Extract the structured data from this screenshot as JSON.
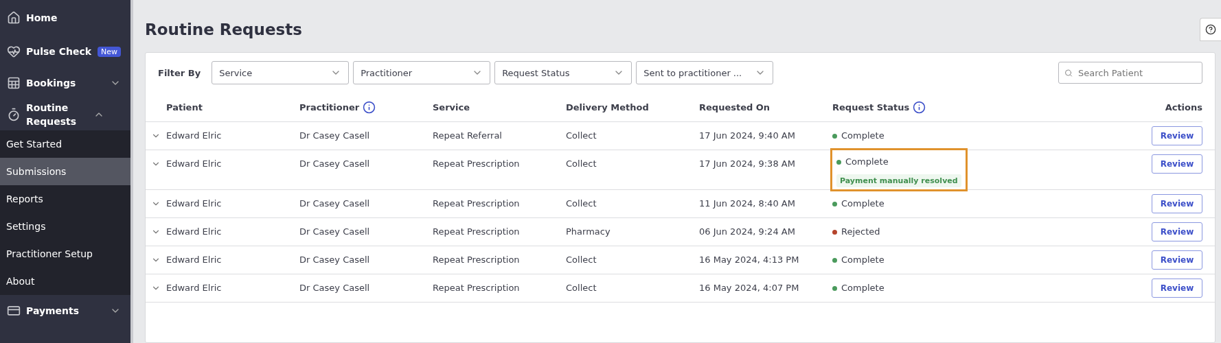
{
  "sidebar": {
    "items": [
      {
        "label": "Home"
      },
      {
        "label": "Pulse Check",
        "badge": "New"
      },
      {
        "label": "Bookings",
        "expanded": false
      },
      {
        "label": "Routine Requests",
        "expanded": true,
        "children": [
          {
            "label": "Get Started",
            "selected": false
          },
          {
            "label": "Submissions",
            "selected": true
          },
          {
            "label": "Reports",
            "selected": false
          },
          {
            "label": "Settings",
            "selected": false
          },
          {
            "label": "Practitioner Setup",
            "selected": false
          },
          {
            "label": "About",
            "selected": false
          }
        ]
      },
      {
        "label": "Payments",
        "expanded": false
      }
    ]
  },
  "page": {
    "title": "Routine Requests"
  },
  "filters": {
    "label": "Filter By",
    "selects": [
      "Service",
      "Practitioner",
      "Request Status",
      "Sent to practitioner ..."
    ],
    "search": {
      "placeholder": "Search Patient"
    }
  },
  "table": {
    "columns": [
      {
        "label": "Patient",
        "info": false
      },
      {
        "label": "Practitioner",
        "info": true
      },
      {
        "label": "Service",
        "info": false
      },
      {
        "label": "Delivery Method",
        "info": false
      },
      {
        "label": "Requested On",
        "info": false
      },
      {
        "label": "Request Status",
        "info": true
      },
      {
        "label": "Actions",
        "info": false
      }
    ],
    "rows": [
      {
        "patient": "Edward Elric",
        "practitioner": "Dr Casey Casell",
        "service": "Repeat Referral",
        "delivery": "Collect",
        "requested": "17 Jun 2024, 9:40 AM",
        "status": "Complete",
        "color": "#4a9a5c",
        "action": "Review",
        "highlighted": false
      },
      {
        "patient": "Edward Elric",
        "practitioner": "Dr Casey Casell",
        "service": "Repeat Prescription",
        "delivery": "Collect",
        "requested": "17 Jun 2024, 9:38 AM",
        "status": "Complete",
        "color": "#4a9a5c",
        "tag": "Payment manually resolved",
        "action": "Review",
        "highlighted": true
      },
      {
        "patient": "Edward Elric",
        "practitioner": "Dr Casey Casell",
        "service": "Repeat Prescription",
        "delivery": "Collect",
        "requested": "11 Jun 2024, 8:40 AM",
        "status": "Complete",
        "color": "#4a9a5c",
        "action": "Review",
        "highlighted": false
      },
      {
        "patient": "Edward Elric",
        "practitioner": "Dr Casey Casell",
        "service": "Repeat Prescription",
        "delivery": "Pharmacy",
        "requested": "06 Jun 2024, 9:24 AM",
        "status": "Rejected",
        "color": "#b5442c",
        "action": "Review",
        "highlighted": false
      },
      {
        "patient": "Edward Elric",
        "practitioner": "Dr Casey Casell",
        "service": "Repeat Prescription",
        "delivery": "Collect",
        "requested": "16 May 2024, 4:13 PM",
        "status": "Complete",
        "color": "#4a9a5c",
        "action": "Review",
        "highlighted": false
      },
      {
        "patient": "Edward Elric",
        "practitioner": "Dr Casey Casell",
        "service": "Repeat Prescription",
        "delivery": "Collect",
        "requested": "16 May 2024, 4:07 PM",
        "status": "Complete",
        "color": "#4a9a5c",
        "action": "Review",
        "highlighted": false
      }
    ]
  }
}
